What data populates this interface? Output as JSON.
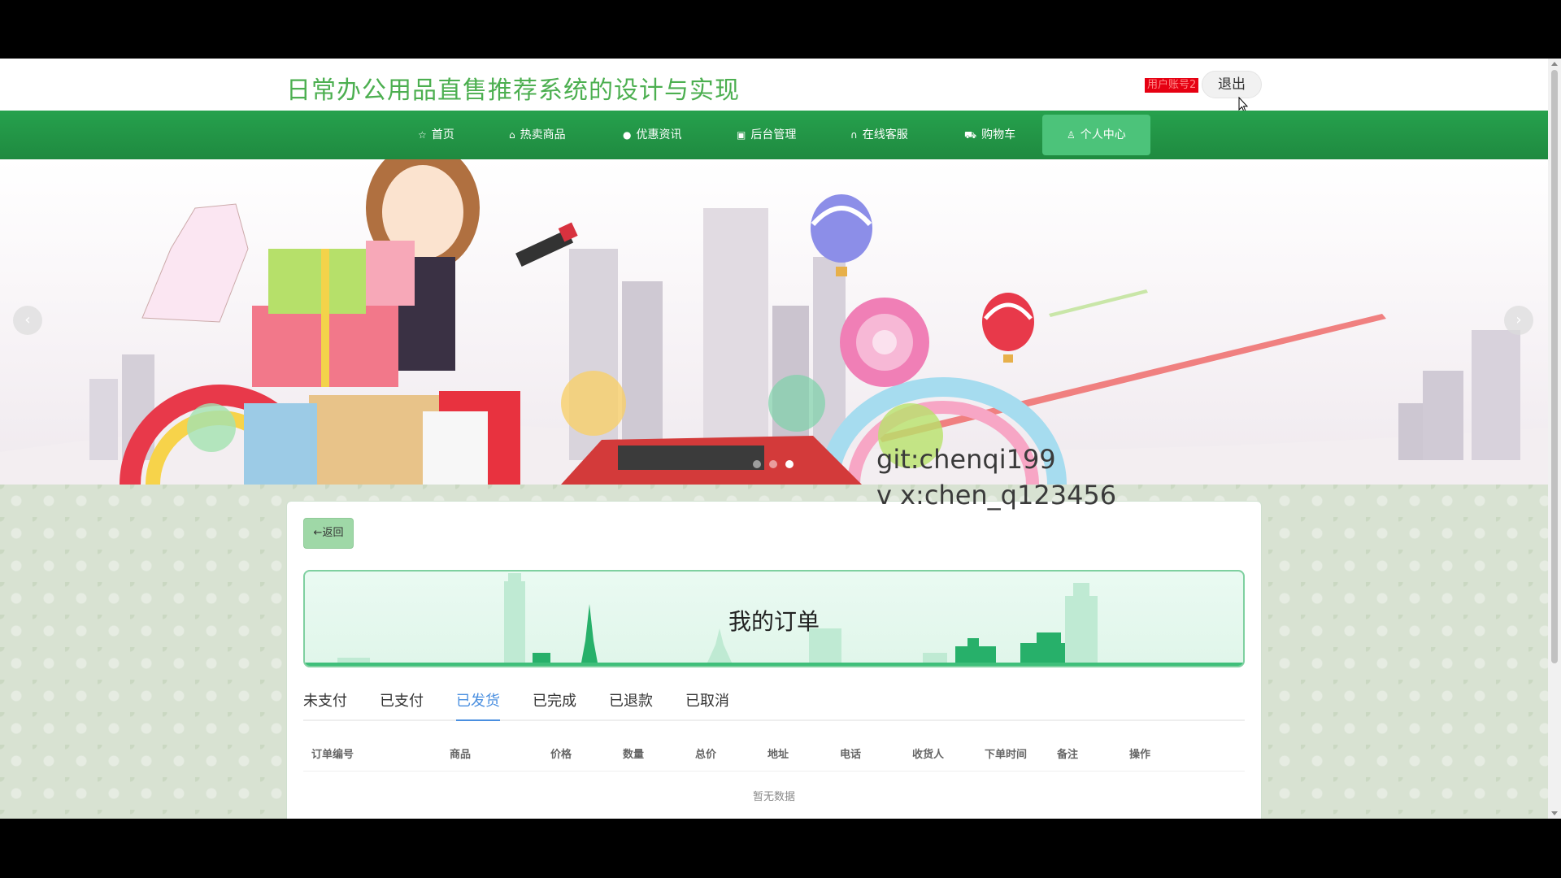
{
  "header": {
    "site_title": "日常办公用品直售推荐系统的设计与实现",
    "user_account": "用户账号2",
    "logout_label": "退出"
  },
  "nav": {
    "items": [
      {
        "label": "首页",
        "icon": "star-icon"
      },
      {
        "label": "热卖商品",
        "icon": "bag-icon"
      },
      {
        "label": "优惠资讯",
        "icon": "info-icon"
      },
      {
        "label": "后台管理",
        "icon": "clipboard-icon"
      },
      {
        "label": "在线客服",
        "icon": "headset-icon"
      },
      {
        "label": "购物车",
        "icon": "cart-icon"
      },
      {
        "label": "个人中心",
        "icon": "user-icon",
        "active": true
      }
    ]
  },
  "banner": {
    "prev_icon": "chevron-left-icon",
    "next_icon": "chevron-right-icon",
    "dots_count": 3,
    "active_dot": 3
  },
  "watermark": {
    "line1": "git:chenqi199",
    "line2": "v x:chen_q123456"
  },
  "orders": {
    "back_label": "←返回",
    "title": "我的订单",
    "tabs": [
      "未支付",
      "已支付",
      "已发货",
      "已完成",
      "已退款",
      "已取消"
    ],
    "active_tab": "已发货",
    "columns": [
      "订单编号",
      "商品",
      "价格",
      "数量",
      "总价",
      "地址",
      "电话",
      "收货人",
      "下单时间",
      "备注",
      "操作"
    ],
    "empty_text": "暂无数据"
  },
  "colors": {
    "nav_green": "#1f8a40",
    "title_green": "#4caf50",
    "active_tab_blue": "#4a8fe0"
  }
}
